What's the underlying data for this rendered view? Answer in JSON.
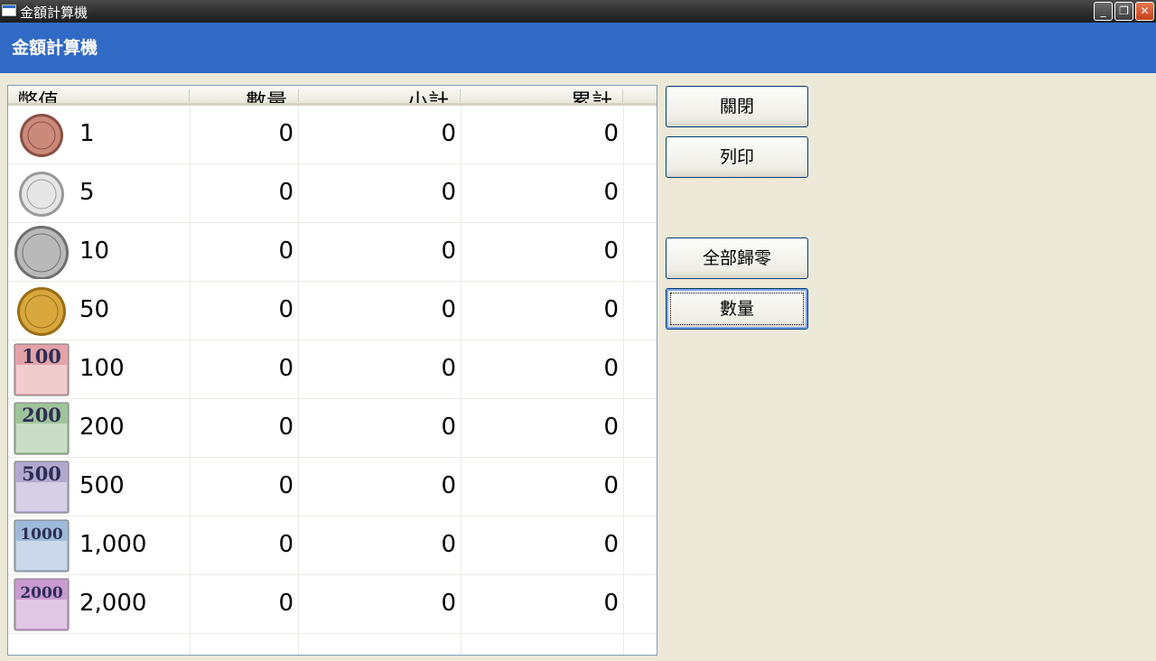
{
  "window": {
    "title": "金額計算機"
  },
  "header": {
    "title": "金額計算機"
  },
  "grid": {
    "columns": [
      "幣值",
      "數量",
      "小計",
      "累計"
    ],
    "rows": [
      {
        "denomination": "1",
        "quantity": "0",
        "subtotal": "0",
        "cumulative": "0",
        "icon": "coin-1-icon"
      },
      {
        "denomination": "5",
        "quantity": "0",
        "subtotal": "0",
        "cumulative": "0",
        "icon": "coin-5-icon"
      },
      {
        "denomination": "10",
        "quantity": "0",
        "subtotal": "0",
        "cumulative": "0",
        "icon": "coin-10-icon"
      },
      {
        "denomination": "50",
        "quantity": "0",
        "subtotal": "0",
        "cumulative": "0",
        "icon": "coin-50-icon"
      },
      {
        "denomination": "100",
        "quantity": "0",
        "subtotal": "0",
        "cumulative": "0",
        "icon": "banknote-100-icon",
        "note_label": "100",
        "color": "#e3a3a8"
      },
      {
        "denomination": "200",
        "quantity": "0",
        "subtotal": "0",
        "cumulative": "0",
        "icon": "banknote-200-icon",
        "note_label": "200",
        "color": "#9fc49a"
      },
      {
        "denomination": "500",
        "quantity": "0",
        "subtotal": "0",
        "cumulative": "0",
        "icon": "banknote-500-icon",
        "note_label": "500",
        "color": "#b3a9cf"
      },
      {
        "denomination": "1,000",
        "quantity": "0",
        "subtotal": "0",
        "cumulative": "0",
        "icon": "banknote-1000-icon",
        "note_label": "1000",
        "color": "#9fb9d8"
      },
      {
        "denomination": "2,000",
        "quantity": "0",
        "subtotal": "0",
        "cumulative": "0",
        "icon": "banknote-2000-icon",
        "note_label": "2000",
        "color": "#c99bd0"
      }
    ]
  },
  "buttons": {
    "close": "關閉",
    "print": "列印",
    "reset_all": "全部歸零",
    "quantity": "數量"
  },
  "colors": {
    "header": "#316ac5",
    "background": "#ece9d8"
  }
}
